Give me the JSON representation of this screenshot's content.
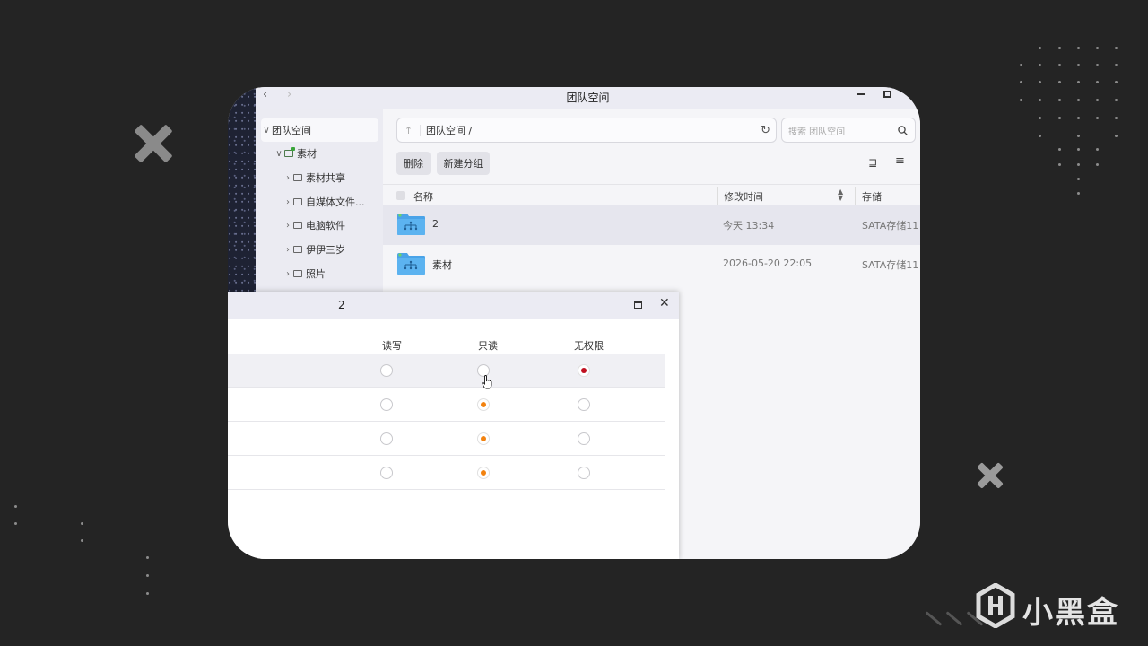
{
  "window": {
    "title": "团队空间"
  },
  "sidebar": {
    "items": [
      {
        "label": "团队空间"
      },
      {
        "label": "素材"
      },
      {
        "label": "素材共享"
      },
      {
        "label": "自媒体文件..."
      },
      {
        "label": "电脑软件"
      },
      {
        "label": "伊伊三岁"
      },
      {
        "label": "照片"
      }
    ]
  },
  "main": {
    "path": "团队空间 /",
    "search_placeholder": "搜索 团队空间",
    "toolbar": {
      "delete_label": "删除",
      "new_group_label": "新建分组"
    },
    "columns": {
      "name": "名称",
      "modified": "修改时间",
      "storage": "存储"
    },
    "rows": [
      {
        "name": "2",
        "modified": "今天 13:34",
        "storage": "SATA存储11"
      },
      {
        "name": "素材",
        "modified": "2026-05-20 22:05",
        "storage": "SATA存储11"
      }
    ]
  },
  "dialog": {
    "title": "2",
    "columns": [
      "读写",
      "只读",
      "无权限"
    ],
    "rows": [
      {
        "selected": "无权限"
      },
      {
        "selected": "只读"
      },
      {
        "selected": "只读"
      },
      {
        "selected": "只读"
      }
    ]
  },
  "watermark": {
    "text": "小黑盒"
  },
  "colors": {
    "radio_orange": "#f2820f",
    "radio_red": "#c01020",
    "folder_blue": "#4aa3e8"
  }
}
